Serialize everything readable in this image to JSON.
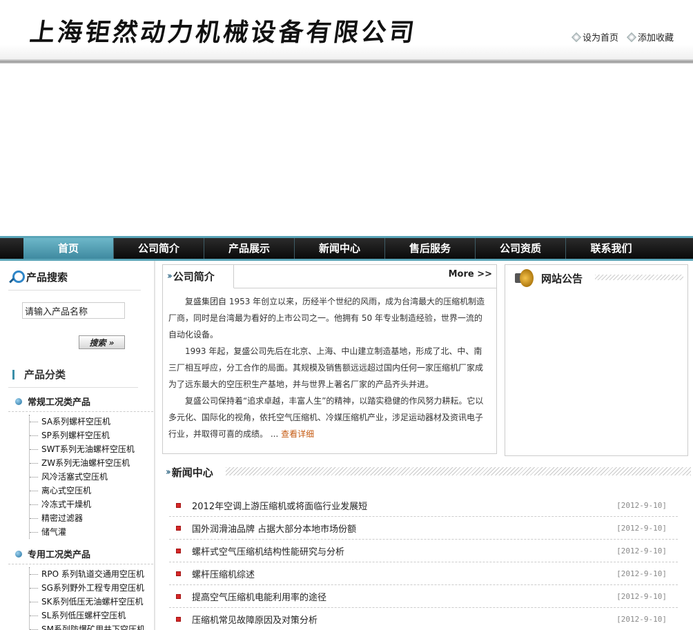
{
  "header": {
    "logo_text": "上海钜然动力机械设备有限公司",
    "set_home": "设为首页",
    "add_favorite": "添加收藏"
  },
  "nav": {
    "items": [
      "首页",
      "公司简介",
      "产品展示",
      "新闻中心",
      "售后服务",
      "公司资质",
      "联系我们"
    ],
    "active_index": 0
  },
  "sidebar": {
    "search_title": "产品搜索",
    "search_value": "请输入产品名称",
    "search_button": "搜索 »",
    "category_title": "产品分类",
    "groups": [
      {
        "title": "常规工况类产品",
        "items": [
          "SA系列螺杆空压机",
          "SP系列螺杆空压机",
          "SWT系列无油螺杆空压机",
          "ZW系列无油螺杆空压机",
          "风冷活塞式空压机",
          "离心式空压机",
          "冷冻式干燥机",
          "精密过滤器",
          "储气灌"
        ]
      },
      {
        "title": "专用工况类产品",
        "items": [
          "RPO 系列轨道交通用空压机",
          "SG系列野外工程专用空压机",
          "SK系列低压无油螺杆空压机",
          "SL系列低压螺杆空压机",
          "SM系列防爆矿用井下空压机"
        ]
      }
    ]
  },
  "intro": {
    "title": "公司简介",
    "more": "More >>",
    "paragraphs": [
      "复盛集团自 1953 年创立以来，历经半个世纪的风雨，成为台湾最大的压缩机制造厂商，同时是台湾最为看好的上市公司之一。他拥有 50 年专业制造经验，世界一流的自动化设备。",
      "1993 年起，复盛公司先后在北京、上海、中山建立制造基地，形成了北、中、南三厂相互呼应，分工合作的局面。其规模及销售额远远超过国内任何一家压缩机厂家成为了远东最大的空压积生产基地，并与世界上著名厂家的产品齐头并进。",
      "复盛公司保持着“追求卓越，丰富人生”的精神，以踏实稳健的作风努力耕耘。它以多元化、国际化的视角，依托空气压缩机、冷媒压缩机产业，涉足运动器材及资讯电子行业，并取得可喜的成绩。 ... "
    ],
    "detail_link": "查看详细"
  },
  "notice": {
    "title": "网站公告"
  },
  "news": {
    "title": "新闻中心",
    "items": [
      {
        "title": "2012年空调上游压缩机或将面临行业发展短",
        "date": "[2012-9-10]"
      },
      {
        "title": "国外润滑油品牌 占据大部分本地市场份额",
        "date": "[2012-9-10]"
      },
      {
        "title": "螺杆式空气压缩机结构性能研究与分析",
        "date": "[2012-9-10]"
      },
      {
        "title": "螺杆压缩机综述",
        "date": "[2012-9-10]"
      },
      {
        "title": "提高空气压缩机电能利用率的途径",
        "date": "[2012-9-10]"
      },
      {
        "title": "压缩机常见故障原因及对策分析",
        "date": "[2012-9-10]"
      }
    ]
  },
  "colors": {
    "nav_accent": "#5aa5b8",
    "link_orange": "#c55a11",
    "bullet_red": "#d62828"
  }
}
